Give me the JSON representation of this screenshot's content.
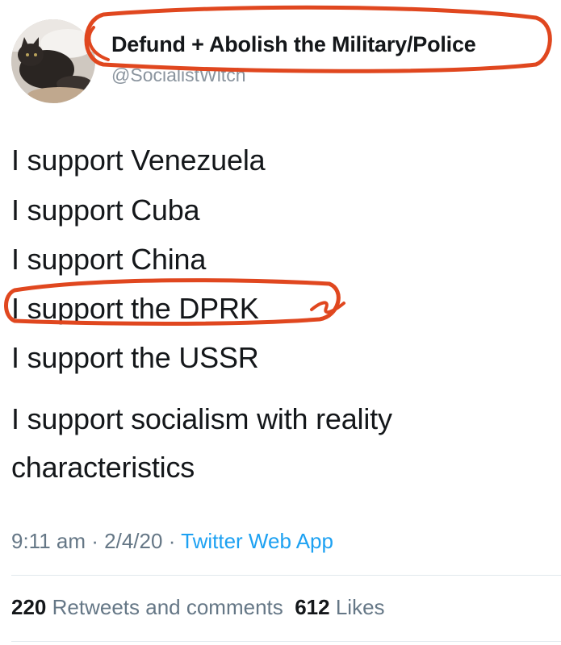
{
  "tweet": {
    "display_name": "Defund + Abolish the Military/Police",
    "handle": "@SocialistWitch",
    "lines": [
      "I support Venezuela",
      "I support Cuba",
      "I support China",
      "I support the DPRK",
      "I support the USSR",
      "I support socialism with reality",
      "characteristics"
    ],
    "time": "9:11 am",
    "date": "2/4/20",
    "separator": "·",
    "source_app": "Twitter Web App",
    "retweets_count": "220",
    "retweets_label": "Retweets and comments",
    "likes_count": "612",
    "likes_label": "Likes"
  },
  "colors": {
    "annotation": "#e0471f",
    "link": "#1da1f2",
    "muted": "#657786"
  }
}
